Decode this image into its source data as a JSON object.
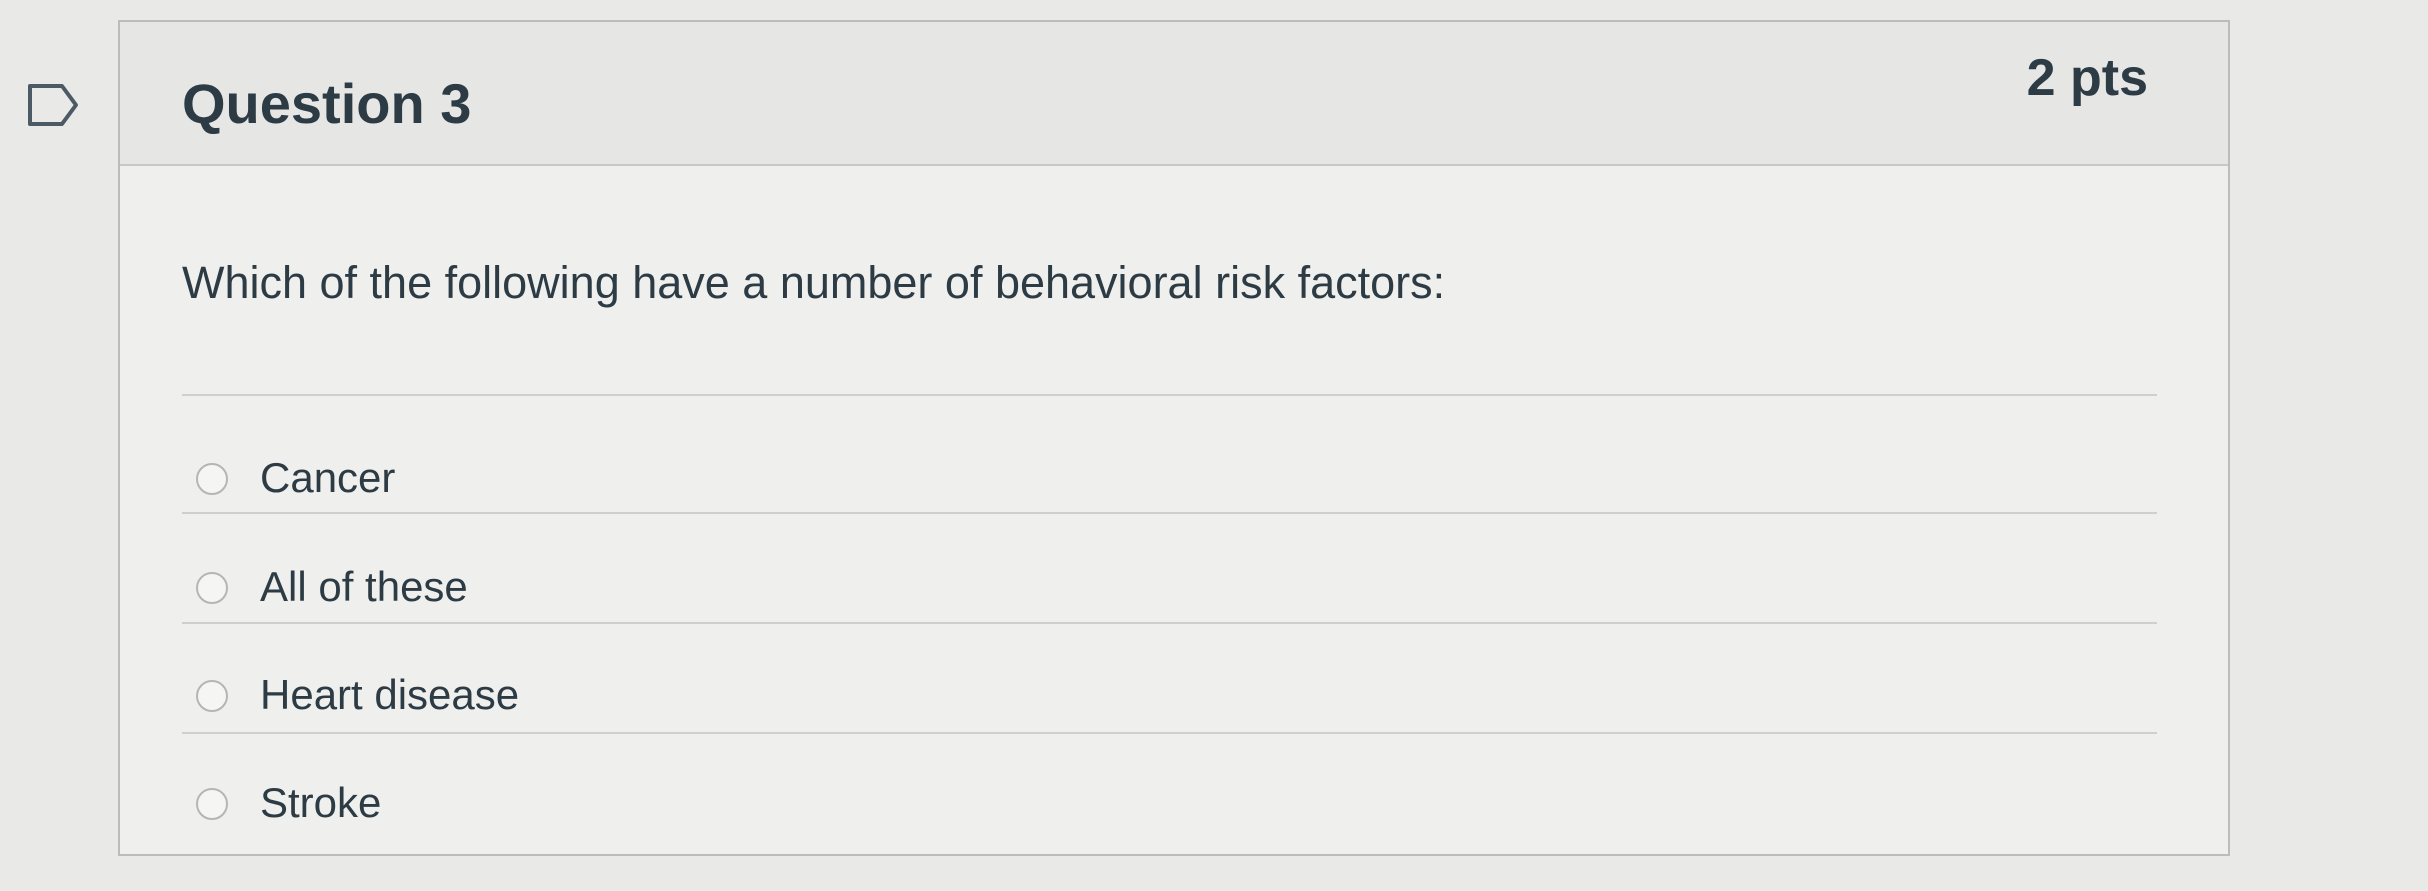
{
  "question": {
    "title": "Question 3",
    "points": "2 pts",
    "text": "Which of the following have a number of behavioral risk factors:"
  },
  "answers": [
    {
      "label": "Cancer",
      "selected": false
    },
    {
      "label": "All of these",
      "selected": false
    },
    {
      "label": "Heart disease",
      "selected": false
    },
    {
      "label": "Stroke",
      "selected": false
    }
  ],
  "icons": {
    "flag": "flag-question-icon",
    "radio": "radio-button-icon"
  }
}
